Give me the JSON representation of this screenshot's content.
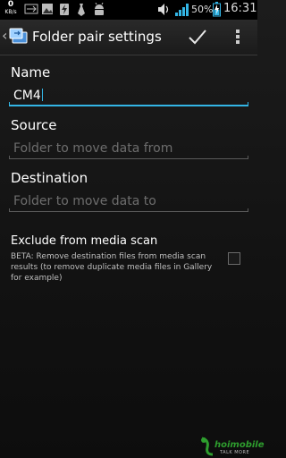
{
  "status_bar": {
    "net_speed": "0",
    "net_unit": "KB/s",
    "battery_percent": "50%",
    "time": "16:31",
    "icons": [
      "data-speed-icon",
      "usb-icon",
      "image-icon",
      "bolt-icon",
      "tie-icon",
      "android-debug-icon",
      "volume-icon",
      "signal-icon",
      "battery-charging-icon"
    ],
    "accent_color": "#33b5e5"
  },
  "action_bar": {
    "title": "Folder pair settings",
    "confirm_icon": "check-icon",
    "overflow_icon": "overflow-menu-icon"
  },
  "form": {
    "name": {
      "label": "Name",
      "value": "CM4"
    },
    "source": {
      "label": "Source",
      "placeholder": "Folder to move data from"
    },
    "destination": {
      "label": "Destination",
      "placeholder": "Folder to move data to"
    },
    "exclude": {
      "title": "Exclude from media scan",
      "description": "BETA: Remove destination files from media scan results (to remove duplicate media files in Gallery for example)",
      "checked": false
    }
  },
  "watermark": {
    "brand": "hoimobile",
    "tagline": "TALK MORE"
  }
}
